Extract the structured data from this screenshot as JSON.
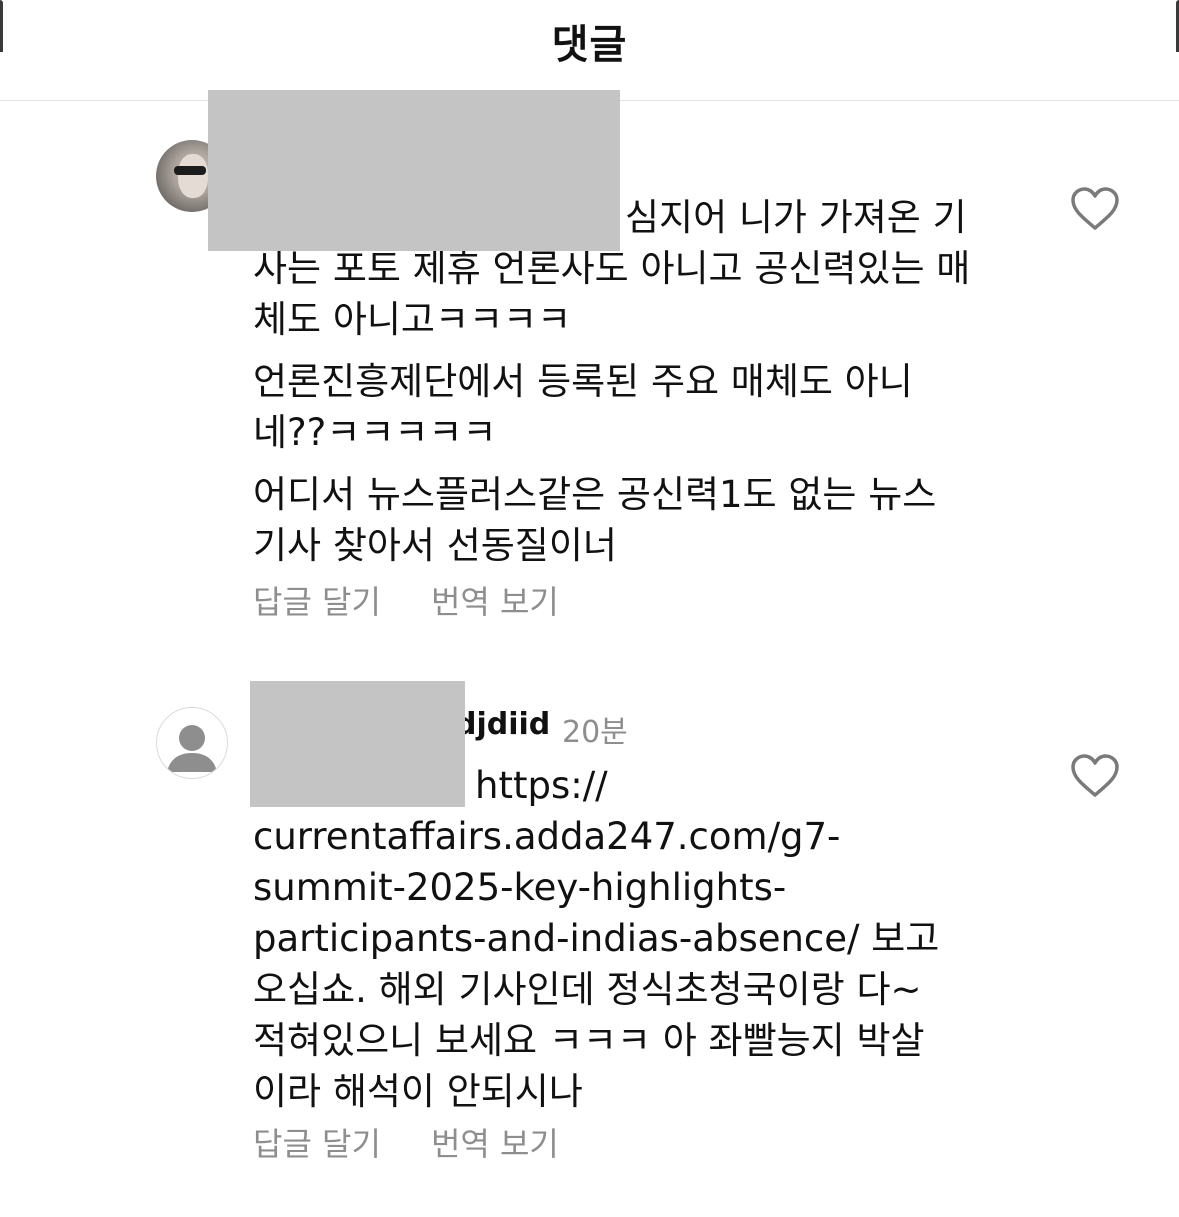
{
  "header": {
    "title": "댓글"
  },
  "comments": [
    {
      "avatar_icon": "user-photo-avatar",
      "username": "",
      "time": "",
      "paragraphs": [
        {
          "lines": [
            "심지어 니가 가져온 기",
            "사는 포토 제휴 언론사도 아니고 공신력있는 매",
            "체도 아니고ㅋㅋㅋㅋ"
          ]
        },
        {
          "lines": [
            "언론진흥제단에서 등록된 주요 매체도 아니",
            "네??ㅋㅋㅋㅋㅋ"
          ]
        },
        {
          "lines": [
            "어디서 뉴스플러스같은 공신력1도 없는 뉴스",
            "기사 찾아서 선동질이너"
          ]
        }
      ],
      "reply_label": "답글 달기",
      "translate_label": "번역 보기",
      "like_icon": "heart-outline-icon"
    },
    {
      "avatar_icon": "default-user-avatar",
      "username": "djdiid",
      "time": "20분",
      "paragraphs": [
        {
          "lines": [
            "https://",
            "currentaffairs.adda247.com/g7-",
            "summit-2025-key-highlights-",
            "participants-and-indias-absence/  보고",
            "오십쇼. 해외 기사인데 정식초청국이랑 다~",
            "적혀있으니 보세요 ㅋㅋㅋ 아 좌빨능지 박살",
            "이라 해석이 안되시나"
          ]
        }
      ],
      "reply_label": "답글 달기",
      "translate_label": "번역 보기",
      "like_icon": "heart-outline-icon"
    }
  ]
}
